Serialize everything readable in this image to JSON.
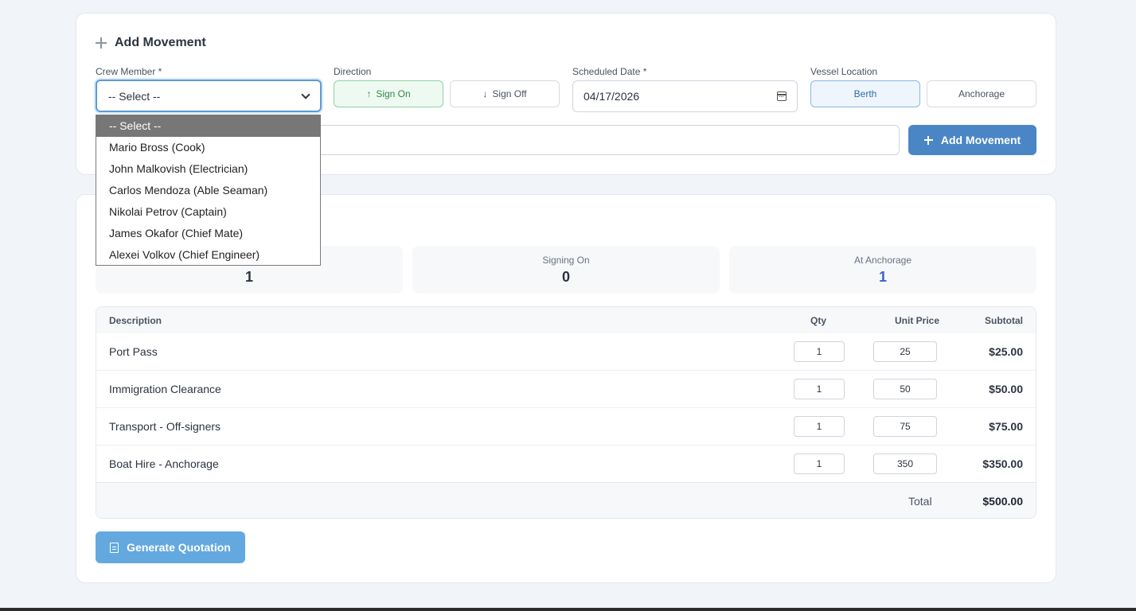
{
  "movement_form": {
    "title": "Add Movement",
    "crew_label": "Crew Member *",
    "crew_selected": "-- Select --",
    "direction_label": "Direction",
    "sign_on_label": "Sign On",
    "sign_off_label": "Sign Off",
    "date_label": "Scheduled Date *",
    "date_value": "04/17/2026",
    "location_label": "Vessel Location",
    "berth_label": "Berth",
    "anchorage_label": "Anchorage",
    "notes_value": "",
    "submit_label": "Add Movement"
  },
  "crew_dropdown": {
    "options": [
      "-- Select --",
      "Mario Bross (Cook)",
      "John Malkovish (Electrician)",
      "Carlos Mendoza (Able Seaman)",
      "Nikolai Petrov (Captain)",
      "James Okafor (Chief Mate)",
      "Alexei Volkov (Chief Engineer)"
    ]
  },
  "stats": [
    {
      "label": "",
      "value": "1"
    },
    {
      "label": "Signing On",
      "value": "0"
    },
    {
      "label": "At Anchorage",
      "value": "1"
    }
  ],
  "quote_table": {
    "headers": {
      "description": "Description",
      "qty": "Qty",
      "unit_price": "Unit Price",
      "subtotal": "Subtotal"
    },
    "rows": [
      {
        "description": "Port Pass",
        "qty": "1",
        "unit_price": "25",
        "subtotal": "$25.00"
      },
      {
        "description": "Immigration Clearance",
        "qty": "1",
        "unit_price": "50",
        "subtotal": "$50.00"
      },
      {
        "description": "Transport - Off-signers",
        "qty": "1",
        "unit_price": "75",
        "subtotal": "$75.00"
      },
      {
        "description": "Boat Hire - Anchorage",
        "qty": "1",
        "unit_price": "350",
        "subtotal": "$350.00"
      }
    ],
    "total_label": "Total",
    "total_value": "$500.00"
  },
  "generate_label": "Generate Quotation",
  "colors": {
    "accent": "#4a86c6",
    "success": "#2f8a4d",
    "stat_blue": "#3e63c2"
  }
}
